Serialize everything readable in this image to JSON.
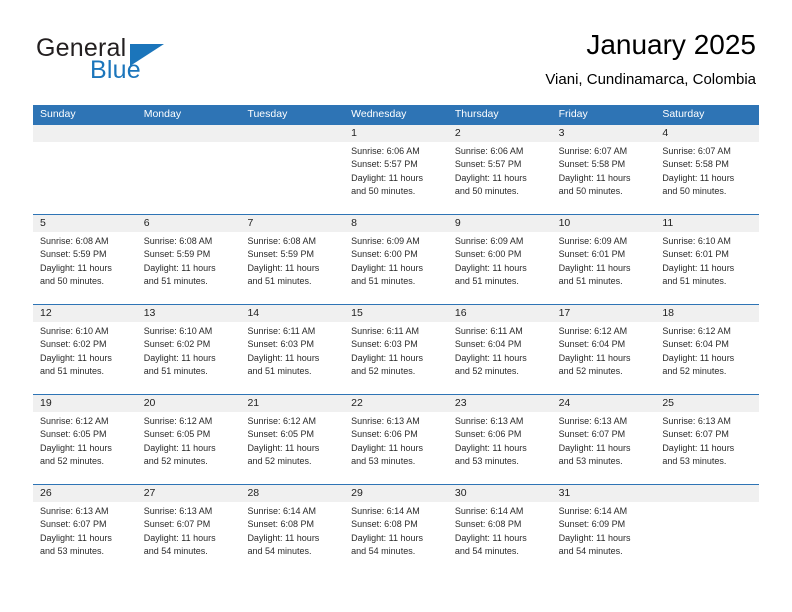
{
  "brand": {
    "name_part1": "General",
    "name_part2": "Blue",
    "logo_icon": "blue-triangle-logo",
    "colors": {
      "text": "#231f20",
      "accent": "#1b75bb"
    }
  },
  "header": {
    "title": "January 2025",
    "subtitle": "Viani, Cundinamarca, Colombia"
  },
  "theme": {
    "header_blue": "#2E74B5",
    "daynum_band": "#F0F0F0",
    "body_text": "#2A2A2A"
  },
  "calendar": {
    "weekdays": [
      "Sunday",
      "Monday",
      "Tuesday",
      "Wednesday",
      "Thursday",
      "Friday",
      "Saturday"
    ],
    "labels": {
      "sunrise": "Sunrise:",
      "sunset": "Sunset:",
      "daylight": "Daylight:"
    },
    "weeks": [
      [
        {
          "day": "",
          "sunrise": "",
          "sunset": "",
          "daylight_line1": "",
          "daylight_line2": ""
        },
        {
          "day": "",
          "sunrise": "",
          "sunset": "",
          "daylight_line1": "",
          "daylight_line2": ""
        },
        {
          "day": "",
          "sunrise": "",
          "sunset": "",
          "daylight_line1": "",
          "daylight_line2": ""
        },
        {
          "day": "1",
          "sunrise": "Sunrise: 6:06 AM",
          "sunset": "Sunset: 5:57 PM",
          "daylight_line1": "Daylight: 11 hours",
          "daylight_line2": "and 50 minutes."
        },
        {
          "day": "2",
          "sunrise": "Sunrise: 6:06 AM",
          "sunset": "Sunset: 5:57 PM",
          "daylight_line1": "Daylight: 11 hours",
          "daylight_line2": "and 50 minutes."
        },
        {
          "day": "3",
          "sunrise": "Sunrise: 6:07 AM",
          "sunset": "Sunset: 5:58 PM",
          "daylight_line1": "Daylight: 11 hours",
          "daylight_line2": "and 50 minutes."
        },
        {
          "day": "4",
          "sunrise": "Sunrise: 6:07 AM",
          "sunset": "Sunset: 5:58 PM",
          "daylight_line1": "Daylight: 11 hours",
          "daylight_line2": "and 50 minutes."
        }
      ],
      [
        {
          "day": "5",
          "sunrise": "Sunrise: 6:08 AM",
          "sunset": "Sunset: 5:59 PM",
          "daylight_line1": "Daylight: 11 hours",
          "daylight_line2": "and 50 minutes."
        },
        {
          "day": "6",
          "sunrise": "Sunrise: 6:08 AM",
          "sunset": "Sunset: 5:59 PM",
          "daylight_line1": "Daylight: 11 hours",
          "daylight_line2": "and 51 minutes."
        },
        {
          "day": "7",
          "sunrise": "Sunrise: 6:08 AM",
          "sunset": "Sunset: 5:59 PM",
          "daylight_line1": "Daylight: 11 hours",
          "daylight_line2": "and 51 minutes."
        },
        {
          "day": "8",
          "sunrise": "Sunrise: 6:09 AM",
          "sunset": "Sunset: 6:00 PM",
          "daylight_line1": "Daylight: 11 hours",
          "daylight_line2": "and 51 minutes."
        },
        {
          "day": "9",
          "sunrise": "Sunrise: 6:09 AM",
          "sunset": "Sunset: 6:00 PM",
          "daylight_line1": "Daylight: 11 hours",
          "daylight_line2": "and 51 minutes."
        },
        {
          "day": "10",
          "sunrise": "Sunrise: 6:09 AM",
          "sunset": "Sunset: 6:01 PM",
          "daylight_line1": "Daylight: 11 hours",
          "daylight_line2": "and 51 minutes."
        },
        {
          "day": "11",
          "sunrise": "Sunrise: 6:10 AM",
          "sunset": "Sunset: 6:01 PM",
          "daylight_line1": "Daylight: 11 hours",
          "daylight_line2": "and 51 minutes."
        }
      ],
      [
        {
          "day": "12",
          "sunrise": "Sunrise: 6:10 AM",
          "sunset": "Sunset: 6:02 PM",
          "daylight_line1": "Daylight: 11 hours",
          "daylight_line2": "and 51 minutes."
        },
        {
          "day": "13",
          "sunrise": "Sunrise: 6:10 AM",
          "sunset": "Sunset: 6:02 PM",
          "daylight_line1": "Daylight: 11 hours",
          "daylight_line2": "and 51 minutes."
        },
        {
          "day": "14",
          "sunrise": "Sunrise: 6:11 AM",
          "sunset": "Sunset: 6:03 PM",
          "daylight_line1": "Daylight: 11 hours",
          "daylight_line2": "and 51 minutes."
        },
        {
          "day": "15",
          "sunrise": "Sunrise: 6:11 AM",
          "sunset": "Sunset: 6:03 PM",
          "daylight_line1": "Daylight: 11 hours",
          "daylight_line2": "and 52 minutes."
        },
        {
          "day": "16",
          "sunrise": "Sunrise: 6:11 AM",
          "sunset": "Sunset: 6:04 PM",
          "daylight_line1": "Daylight: 11 hours",
          "daylight_line2": "and 52 minutes."
        },
        {
          "day": "17",
          "sunrise": "Sunrise: 6:12 AM",
          "sunset": "Sunset: 6:04 PM",
          "daylight_line1": "Daylight: 11 hours",
          "daylight_line2": "and 52 minutes."
        },
        {
          "day": "18",
          "sunrise": "Sunrise: 6:12 AM",
          "sunset": "Sunset: 6:04 PM",
          "daylight_line1": "Daylight: 11 hours",
          "daylight_line2": "and 52 minutes."
        }
      ],
      [
        {
          "day": "19",
          "sunrise": "Sunrise: 6:12 AM",
          "sunset": "Sunset: 6:05 PM",
          "daylight_line1": "Daylight: 11 hours",
          "daylight_line2": "and 52 minutes."
        },
        {
          "day": "20",
          "sunrise": "Sunrise: 6:12 AM",
          "sunset": "Sunset: 6:05 PM",
          "daylight_line1": "Daylight: 11 hours",
          "daylight_line2": "and 52 minutes."
        },
        {
          "day": "21",
          "sunrise": "Sunrise: 6:12 AM",
          "sunset": "Sunset: 6:05 PM",
          "daylight_line1": "Daylight: 11 hours",
          "daylight_line2": "and 52 minutes."
        },
        {
          "day": "22",
          "sunrise": "Sunrise: 6:13 AM",
          "sunset": "Sunset: 6:06 PM",
          "daylight_line1": "Daylight: 11 hours",
          "daylight_line2": "and 53 minutes."
        },
        {
          "day": "23",
          "sunrise": "Sunrise: 6:13 AM",
          "sunset": "Sunset: 6:06 PM",
          "daylight_line1": "Daylight: 11 hours",
          "daylight_line2": "and 53 minutes."
        },
        {
          "day": "24",
          "sunrise": "Sunrise: 6:13 AM",
          "sunset": "Sunset: 6:07 PM",
          "daylight_line1": "Daylight: 11 hours",
          "daylight_line2": "and 53 minutes."
        },
        {
          "day": "25",
          "sunrise": "Sunrise: 6:13 AM",
          "sunset": "Sunset: 6:07 PM",
          "daylight_line1": "Daylight: 11 hours",
          "daylight_line2": "and 53 minutes."
        }
      ],
      [
        {
          "day": "26",
          "sunrise": "Sunrise: 6:13 AM",
          "sunset": "Sunset: 6:07 PM",
          "daylight_line1": "Daylight: 11 hours",
          "daylight_line2": "and 53 minutes."
        },
        {
          "day": "27",
          "sunrise": "Sunrise: 6:13 AM",
          "sunset": "Sunset: 6:07 PM",
          "daylight_line1": "Daylight: 11 hours",
          "daylight_line2": "and 54 minutes."
        },
        {
          "day": "28",
          "sunrise": "Sunrise: 6:14 AM",
          "sunset": "Sunset: 6:08 PM",
          "daylight_line1": "Daylight: 11 hours",
          "daylight_line2": "and 54 minutes."
        },
        {
          "day": "29",
          "sunrise": "Sunrise: 6:14 AM",
          "sunset": "Sunset: 6:08 PM",
          "daylight_line1": "Daylight: 11 hours",
          "daylight_line2": "and 54 minutes."
        },
        {
          "day": "30",
          "sunrise": "Sunrise: 6:14 AM",
          "sunset": "Sunset: 6:08 PM",
          "daylight_line1": "Daylight: 11 hours",
          "daylight_line2": "and 54 minutes."
        },
        {
          "day": "31",
          "sunrise": "Sunrise: 6:14 AM",
          "sunset": "Sunset: 6:09 PM",
          "daylight_line1": "Daylight: 11 hours",
          "daylight_line2": "and 54 minutes."
        },
        {
          "day": "",
          "sunrise": "",
          "sunset": "",
          "daylight_line1": "",
          "daylight_line2": ""
        }
      ]
    ]
  }
}
